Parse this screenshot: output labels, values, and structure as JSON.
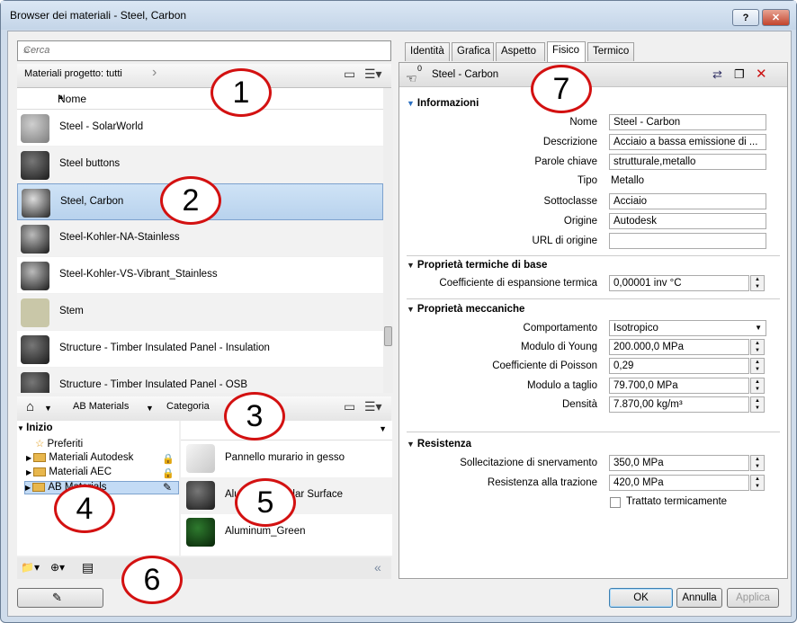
{
  "window": {
    "title": "Browser dei materiali - Steel, Carbon",
    "help": "?",
    "close": "✕"
  },
  "left": {
    "search_placeholder": "Cerca",
    "library_filter": "Materiali progetto: tutti",
    "column_name": "Nome",
    "materials": [
      {
        "name": "Steel - SolarWorld",
        "color": "#a0a0a0"
      },
      {
        "name": "Steel buttons",
        "color": "#3a3a3a"
      },
      {
        "name": "Steel, Carbon",
        "color": "#555555"
      },
      {
        "name": "Steel-Kohler-NA-Stainless",
        "color": "#4a4a4a"
      },
      {
        "name": "Steel-Kohler-VS-Vibrant_Stainless",
        "color": "#4a4a4a"
      },
      {
        "name": "Stem",
        "color": "#c8c6a6"
      },
      {
        "name": "Structure - Timber Insulated Panel - Insulation",
        "color": "#3a3a3a"
      },
      {
        "name": "Structure - Timber Insulated Panel - OSB",
        "color": "#3a3a3a"
      }
    ],
    "breadcrumb": {
      "home": "⌂",
      "lib": "AB Materials",
      "cat": "Categoria"
    },
    "tree": {
      "root": "Inizio",
      "items": [
        "Preferiti",
        "Materiali Autodesk",
        "Materiali AEC",
        "AB Materials"
      ]
    },
    "sub_materials": [
      {
        "name": "Pannello murario in gesso",
        "color": "#dddddd"
      },
      {
        "name": "Aluminum - Solar Surface",
        "color": "#3a3a3a"
      },
      {
        "name": "Aluminum_Green",
        "color": "#1c4d1c"
      }
    ],
    "collapse": "«"
  },
  "right": {
    "tabs": [
      "Identità",
      "Grafica",
      "Aspetto",
      "Fisico",
      "Termico"
    ],
    "asset_name": "Steel - Carbon",
    "asset_count": "0",
    "sections": {
      "info": "Informazioni",
      "thermal": "Proprietà termiche di base",
      "mech": "Proprietà meccaniche",
      "strength": "Resistenza"
    },
    "info": {
      "nome_l": "Nome",
      "nome_v": "Steel - Carbon",
      "desc_l": "Descrizione",
      "desc_v": "Acciaio a bassa emissione di ...",
      "keys_l": "Parole chiave",
      "keys_v": "strutturale,metallo",
      "tipo_l": "Tipo",
      "tipo_v": "Metallo",
      "sub_l": "Sottoclasse",
      "sub_v": "Acciaio",
      "orig_l": "Origine",
      "orig_v": "Autodesk",
      "url_l": "URL di origine",
      "url_v": ""
    },
    "thermal": {
      "coef_l": "Coefficiente di espansione termica",
      "coef_v": "0,00001 inv °C"
    },
    "mech": {
      "comp_l": "Comportamento",
      "comp_v": "Isotropico",
      "young_l": "Modulo di Young",
      "young_v": "200.000,0 MPa",
      "poisson_l": "Coefficiente di Poisson",
      "poisson_v": "0,29",
      "shear_l": "Modulo a taglio",
      "shear_v": "79.700,0 MPa",
      "dens_l": "Densità",
      "dens_v": "7.870,00 kg/m³"
    },
    "strength": {
      "yield_l": "Sollecitazione di snervamento",
      "yield_v": "350,0 MPa",
      "tens_l": "Resistenza alla trazione",
      "tens_v": "420,0 MPa",
      "heat_l": "Trattato termicamente"
    }
  },
  "buttons": {
    "ok": "OK",
    "cancel": "Annulla",
    "apply": "Applica"
  },
  "callouts": [
    "1",
    "2",
    "3",
    "4",
    "5",
    "6",
    "7"
  ]
}
